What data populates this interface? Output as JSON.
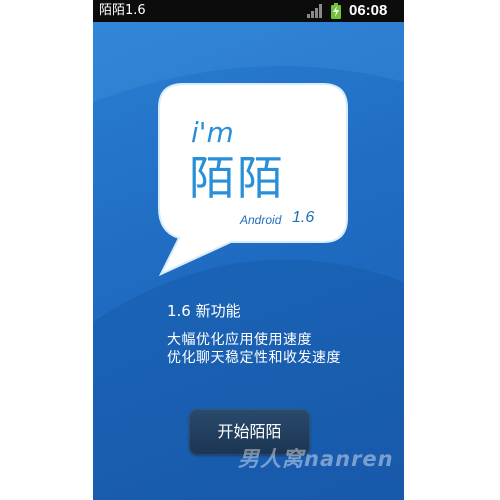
{
  "status_bar": {
    "app_title": "陌陌1.6",
    "time": "06:08",
    "icons": [
      "signal-icon",
      "battery-charging-icon"
    ]
  },
  "splash": {
    "logo": {
      "greeting": "i'm",
      "brand": "陌陌",
      "platform": "Android",
      "version": "1.6"
    },
    "features": {
      "title": "1.6 新功能",
      "lines": [
        "大幅优化应用使用速度",
        "优化聊天稳定性和收发速度"
      ]
    },
    "start_button_label": "开始陌陌",
    "watermark": "男人窝nanren"
  },
  "colors": {
    "background_top": "#2a7fd3",
    "background_bottom": "#1a5fb3",
    "logo_text": "#2a8fd6",
    "button": "#1b3552",
    "status_bar": "#0c0c0c"
  }
}
